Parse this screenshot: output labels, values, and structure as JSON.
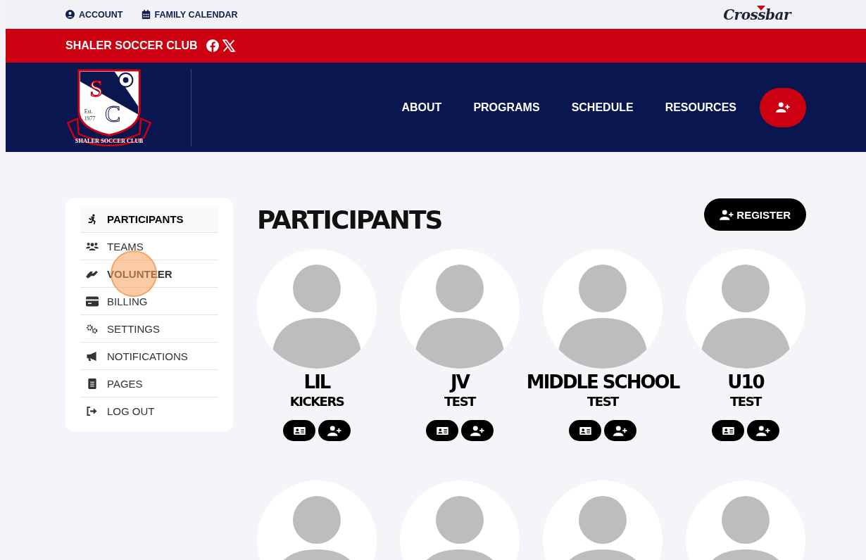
{
  "top_bar": {
    "links": [
      {
        "label": "ACCOUNT"
      },
      {
        "label": "FAMILY CALENDAR"
      }
    ],
    "brand": "Crossbar"
  },
  "club_bar": {
    "name": "SHALER SOCCER CLUB"
  },
  "header": {
    "logo": {
      "initials_top": "S",
      "est": "Est.",
      "year": "1977",
      "initials_bottom": "C",
      "ribbon": "SHALER SOCCER CLUB"
    },
    "nav": [
      "ABOUT",
      "PROGRAMS",
      "SCHEDULE",
      "RESOURCES"
    ]
  },
  "sidebar": {
    "items": [
      {
        "label": "PARTICIPANTS",
        "selected": true,
        "hovered": false
      },
      {
        "label": "TEAMS",
        "selected": false,
        "hovered": false
      },
      {
        "label": "VOLUNTEER",
        "selected": false,
        "hovered": true
      },
      {
        "label": "BILLING",
        "selected": false,
        "hovered": false
      },
      {
        "label": "SETTINGS",
        "selected": false,
        "hovered": false
      },
      {
        "label": "NOTIFICATIONS",
        "selected": false,
        "hovered": false
      },
      {
        "label": "PAGES",
        "selected": false,
        "hovered": false
      },
      {
        "label": "LOG OUT",
        "selected": false,
        "hovered": false
      }
    ]
  },
  "main": {
    "title": "PARTICIPANTS",
    "register_button": "REGISTER",
    "participants": [
      {
        "kind": "card",
        "name": "LIL",
        "team": "KICKERS"
      },
      {
        "kind": "card",
        "name": "JV",
        "team": "TEST"
      },
      {
        "kind": "card",
        "name": "MIDDLE SCHOOL",
        "team": "TEST"
      },
      {
        "kind": "card",
        "name": "U10",
        "team": "TEST"
      },
      {
        "kind": "cut_off"
      },
      {
        "kind": "cut_off"
      },
      {
        "kind": "cut_off"
      },
      {
        "kind": "cut_off"
      }
    ]
  }
}
